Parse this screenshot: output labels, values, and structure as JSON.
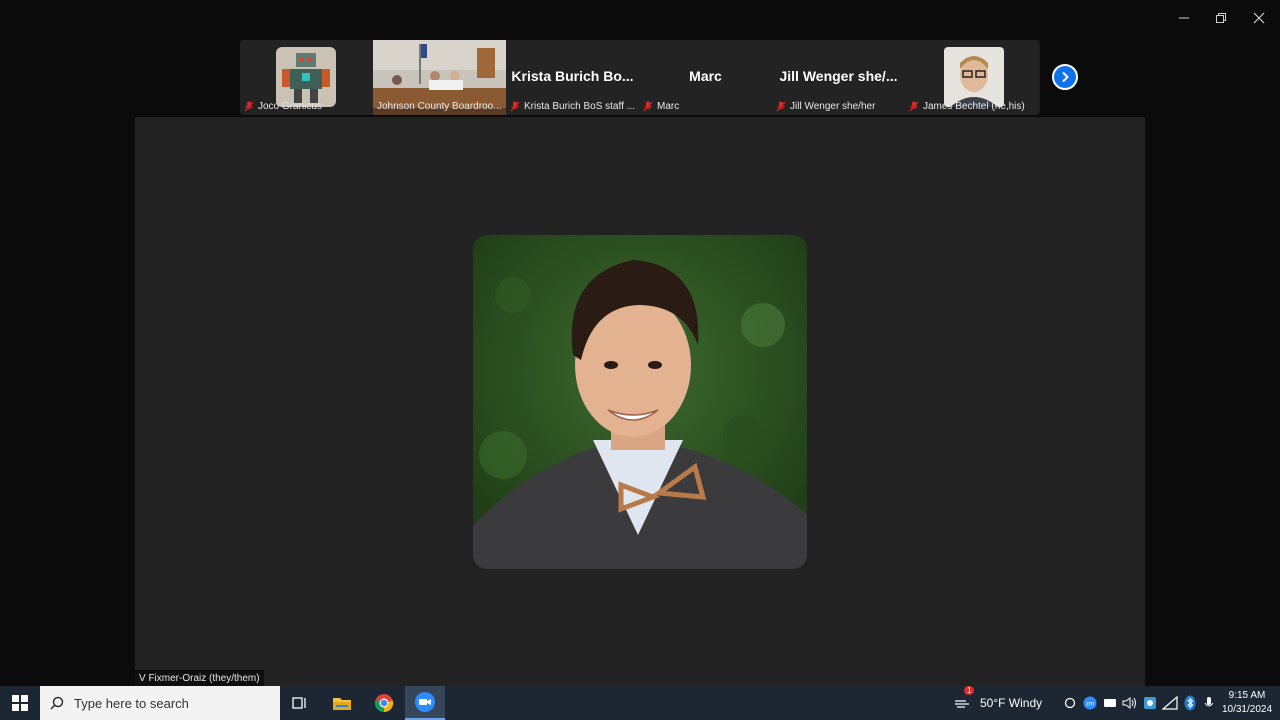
{
  "window_controls": {
    "minimize": "minimize",
    "maximize": "restore",
    "close": "close"
  },
  "gallery": {
    "tiles": [
      {
        "label": "Joco Granicus",
        "big_name": "",
        "muted": true
      },
      {
        "label": "Johnson County Boardroo...",
        "big_name": "",
        "muted": false
      },
      {
        "label": "Krista Burich BoS staff ...",
        "big_name": "Krista Burich Bo...",
        "muted": true
      },
      {
        "label": "Marc",
        "big_name": "Marc",
        "muted": true
      },
      {
        "label": "Jill Wenger she/her",
        "big_name": "Jill Wenger she/...",
        "muted": true
      },
      {
        "label": "James Bechtel (he,his)",
        "big_name": "",
        "muted": true
      }
    ],
    "next_icon": "chevron-right-icon"
  },
  "speaker": {
    "name": "V Fixmer-Oraiz (they/them)"
  },
  "taskbar": {
    "search_placeholder": "Type here to search",
    "weather": "50°F  Windy",
    "weather_badge": "1",
    "time": "9:15 AM",
    "date": "10/31/2024",
    "apps": [
      "task-view-icon",
      "file-explorer-icon",
      "chrome-icon",
      "zoom-icon"
    ]
  },
  "colors": {
    "accent": "#0e72ed",
    "mute": "#e02828",
    "taskbar": "#1c2733"
  }
}
